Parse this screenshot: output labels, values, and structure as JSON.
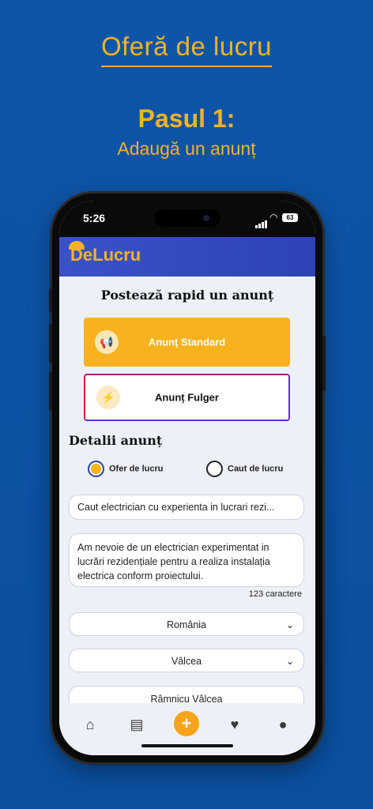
{
  "promo": {
    "title": "Oferă de lucru",
    "step": "Pasul 1:",
    "step_sub": "Adaugă un anunț"
  },
  "status_bar": {
    "time": "5:26",
    "battery": "63"
  },
  "app": {
    "logo_prefix": "De",
    "logo_suffix": "Lucru",
    "brand_color": "#f5b323",
    "header_color": "#3a52c9"
  },
  "post": {
    "title": "Postează rapid un anunț",
    "standard_label": "Anunț Standard",
    "fulger_label": "Anunț Fulger",
    "accent": "#f7b21d"
  },
  "details": {
    "section_title": "Detalii anunț",
    "radio_offer": "Ofer de lucru",
    "radio_search": "Caut de lucru",
    "selected_radio": "Ofer de lucru",
    "title_value": "Caut electrician cu experienta in lucrari rezi...",
    "description_value": "Am nevoie de un electrician experimentat in lucrări rezidențiale pentru a realiza instalația electrica conform proiectului.",
    "char_count": "123 caractere",
    "country": "România",
    "county": "Vâlcea",
    "city": "Râmnicu Vâlcea"
  },
  "nav": {
    "items": [
      "home-icon",
      "documents-icon",
      "add-icon",
      "heart-icon",
      "profile-icon"
    ],
    "plus_symbol": "+"
  }
}
